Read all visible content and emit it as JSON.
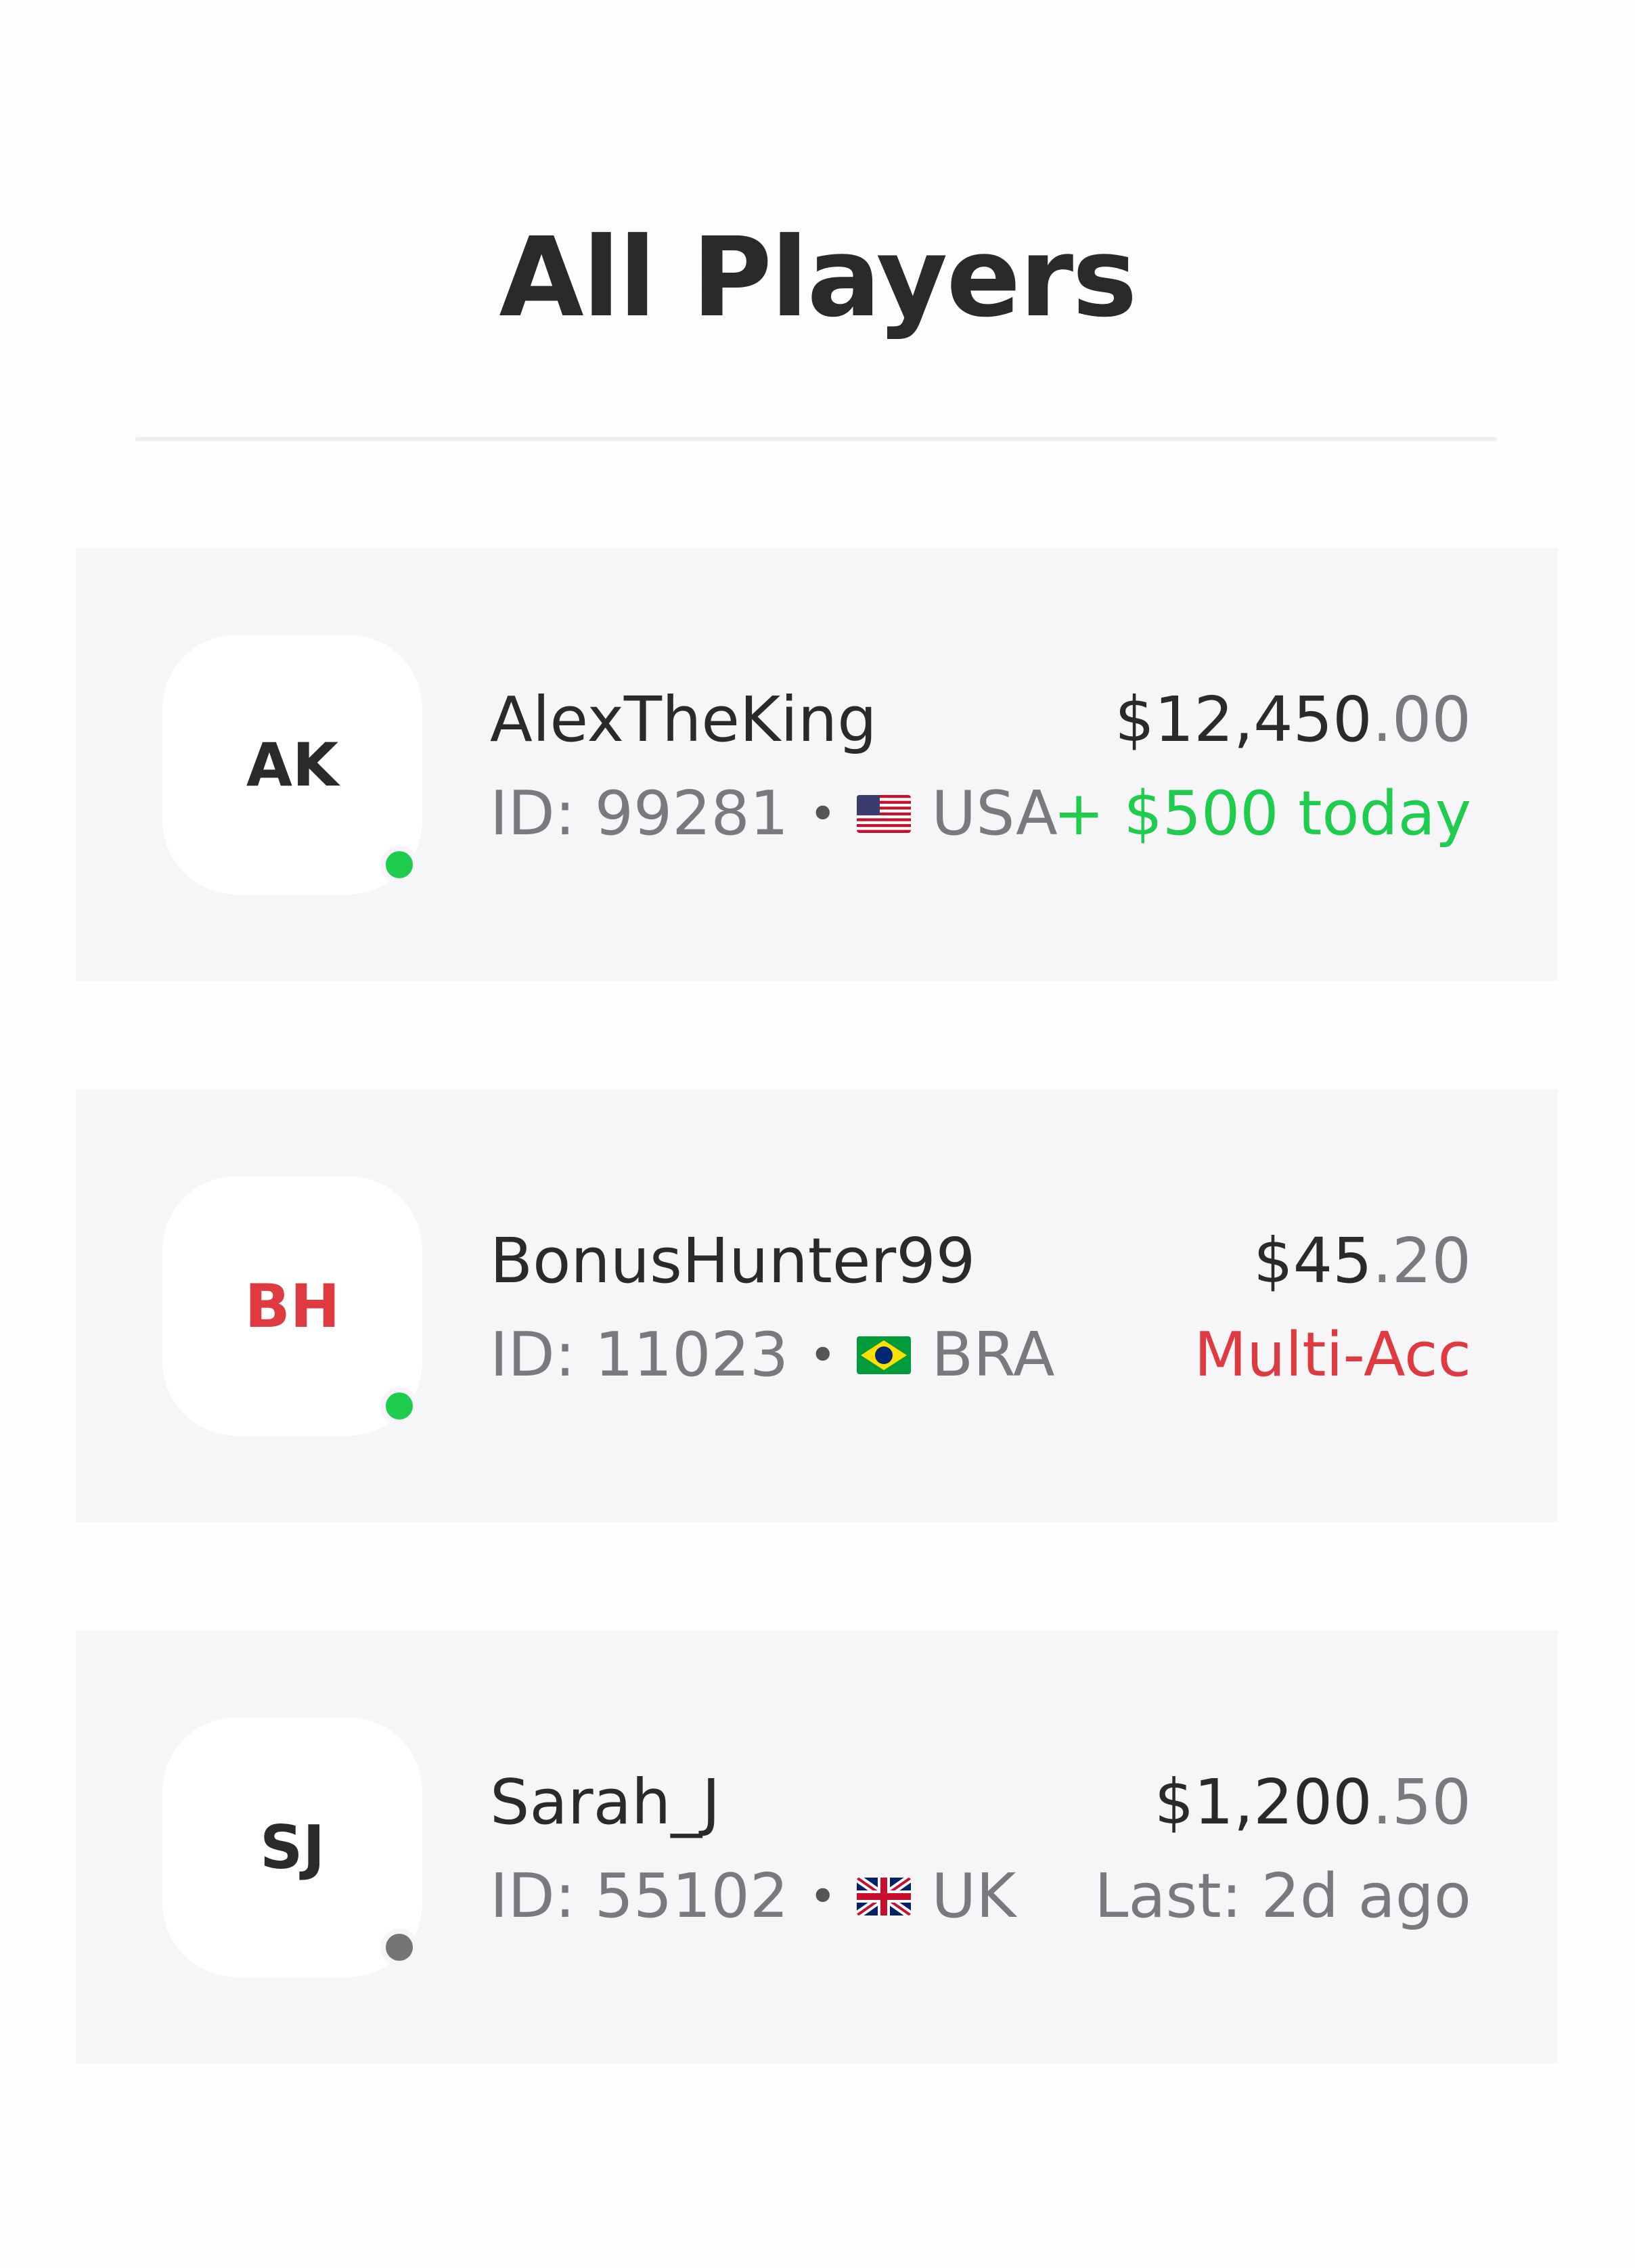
{
  "page": {
    "title": "All Players"
  },
  "colors": {
    "online": "#1fcc4d",
    "offline": "#757578",
    "alert": "#df3a40",
    "positive": "#1fcc4d",
    "card_bg": "#f6f6f8"
  },
  "players": [
    {
      "initials": "AK",
      "name": "AlexTheKing",
      "id_text": "ID: 99281",
      "separator": "•",
      "flag_icon": "flag-usa-icon",
      "country": "USA",
      "balance_main": "$12,450",
      "balance_cents": ".00",
      "sub_text": "+ $500 today",
      "status": "online"
    },
    {
      "initials": "BH",
      "name": "BonusHunter99",
      "id_text": "ID: 11023",
      "separator": "•",
      "flag_icon": "flag-brazil-icon",
      "country": "BRA",
      "balance_main": "$45",
      "balance_cents": ".20",
      "sub_text": "Multi-Acc",
      "status": "online"
    },
    {
      "initials": "SJ",
      "name": "Sarah_J",
      "id_text": "ID: 55102",
      "separator": "•",
      "flag_icon": "flag-uk-icon",
      "country": "UK",
      "balance_main": "$1,200",
      "balance_cents": ".50",
      "sub_text": "Last: 2d ago",
      "status": "offline"
    }
  ]
}
